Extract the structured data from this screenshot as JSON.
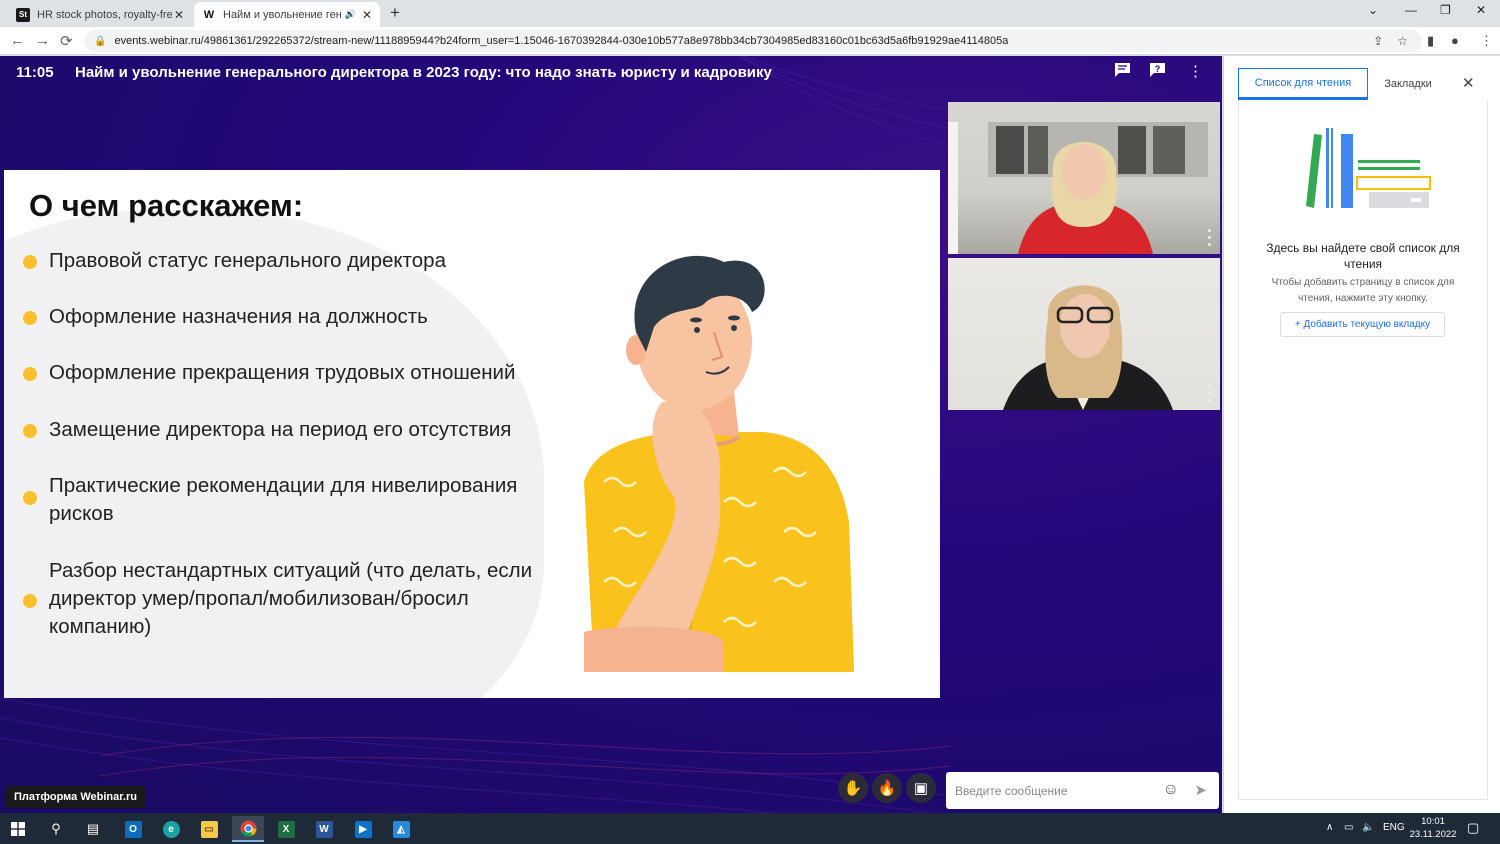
{
  "browser": {
    "tabs": [
      {
        "favicon": "St",
        "title": "HR stock photos, royalty-free im",
        "close": "✕"
      },
      {
        "favicon": "W",
        "title": "Найм и увольнение генера",
        "close": "✕",
        "audio": "🔊"
      }
    ],
    "new_tab": "+",
    "window_controls": {
      "dropdown": "⌄",
      "minimize": "—",
      "restore": "❐",
      "close": "✕"
    },
    "nav": {
      "back": "←",
      "forward": "→",
      "reload": "⟳"
    },
    "url": "events.webinar.ru/49861361/292265372/stream-new/1118895944?b24form_user=1.15046-1670392844-030e10b577a8e978bb34cb7304985ed83160c01bc63d5a6fb91929ae4114805a",
    "icons": [
      "share-icon",
      "star-icon",
      "side-panel-icon",
      "profile-icon",
      "menu-icon"
    ]
  },
  "webinar": {
    "time": "11:05",
    "title": "Найм и увольнение генерального директора в 2023 году: что надо знать юристу и кадровику",
    "top_icons": [
      "chat-icon",
      "question-icon",
      "more-icon"
    ],
    "slide": {
      "heading": "О чем расскажем:",
      "bullets": [
        {
          "lines": [
            "Правовой статус генерального директора"
          ]
        },
        {
          "lines": [
            "Оформление назначения на должность"
          ]
        },
        {
          "lines": [
            "Оформление прекращения трудовых отношений"
          ]
        },
        {
          "lines": [
            "Замещение директора на период его отсутствия"
          ]
        },
        {
          "lines": [
            "Практические рекомендации для нивелирования",
            "рисков"
          ]
        },
        {
          "lines": [
            "Разбор нестандартных ситуаций (что делать, если",
            "директор умер/пропал/мобилизован/бросил",
            "компанию)"
          ]
        }
      ],
      "accent_color": "#fbbf2e"
    },
    "controls": {
      "raise_hand": "✋",
      "reaction": "🔥",
      "screen": "▣"
    },
    "message": {
      "placeholder": "Введите сообщение",
      "emoji": "☺",
      "send": "➤"
    },
    "platform_badge": "Платформа Webinar.ru"
  },
  "side_panel": {
    "tabs": [
      "Список для чтения",
      "Закладки"
    ],
    "close": "✕",
    "heading": "Здесь вы найдете свой список для чтения",
    "subtext": "Чтобы добавить страницу в список для чтения, нажмите эту кнопку.",
    "button": "+  Добавить текущую вкладку"
  },
  "taskbar": {
    "items": [
      "start-icon",
      "search-icon",
      "task-view-icon",
      "outlook-icon",
      "edge-icon",
      "explorer-icon",
      "chrome-icon",
      "excel-icon",
      "word-icon",
      "media-icon",
      "photos-icon"
    ],
    "tray": {
      "lang": "ENG",
      "time": "10:01",
      "date": "23.11.2022",
      "chevron": "∧"
    }
  }
}
